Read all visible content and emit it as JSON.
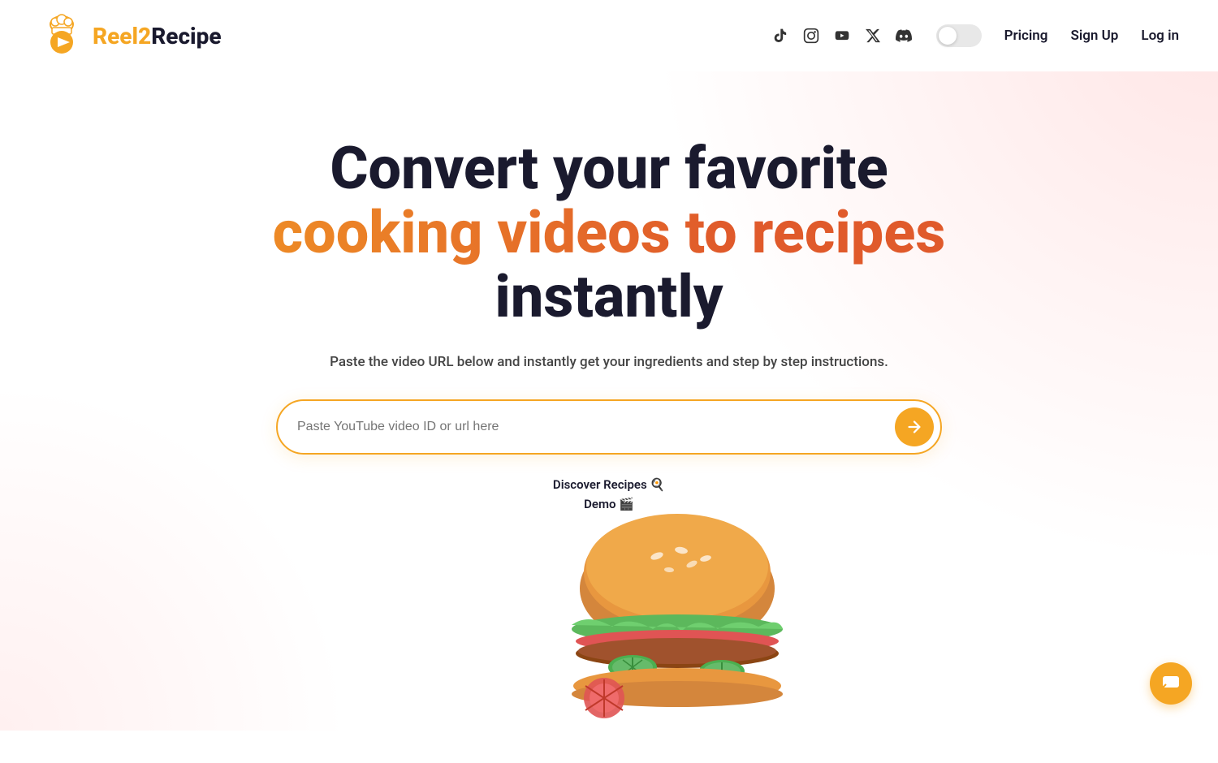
{
  "brand": {
    "name_part1": "Reel2",
    "name_part2": "Recipe"
  },
  "nav": {
    "pricing_label": "Pricing",
    "signup_label": "Sign Up",
    "login_label": "Log in"
  },
  "social": {
    "icons": [
      "tiktok",
      "instagram",
      "youtube",
      "twitter",
      "discord"
    ]
  },
  "hero": {
    "title_line1": "Convert your favorite",
    "title_line2": "cooking videos to recipes",
    "title_line3": "instantly",
    "subtitle": "Paste the video URL below and instantly get your ingredients and step by step instructions.",
    "search_placeholder": "Paste YouTube video ID or url here"
  },
  "links": {
    "discover": "Discover Recipes 🍳",
    "demo": "Demo 🎬"
  },
  "chat_button_label": "chat"
}
